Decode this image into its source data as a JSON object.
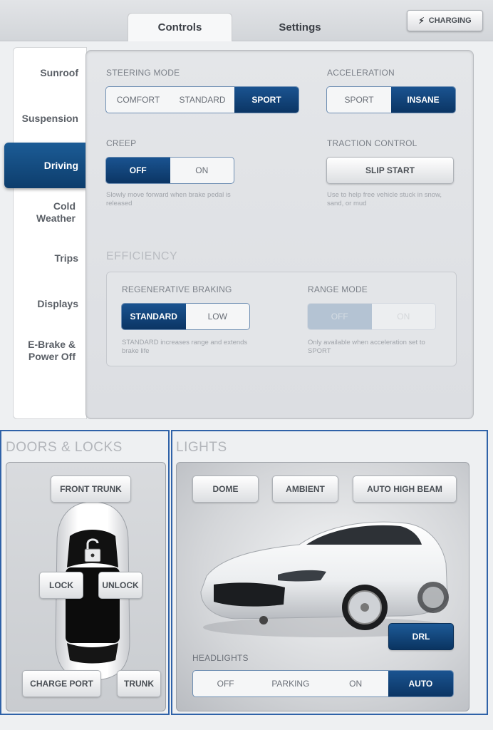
{
  "tabs": [
    "Controls",
    "Settings"
  ],
  "charging_label": "CHARGING",
  "sidebar": {
    "items": [
      "Sunroof",
      "Suspension",
      "Driving",
      "Cold Weather",
      "Trips",
      "Displays",
      "E-Brake & Power Off"
    ],
    "active": "Driving"
  },
  "driving": {
    "steering_mode": {
      "label": "STEERING MODE",
      "options": [
        "COMFORT",
        "STANDARD",
        "SPORT"
      ],
      "selected": "SPORT"
    },
    "acceleration": {
      "label": "ACCELERATION",
      "options": [
        "SPORT",
        "INSANE"
      ],
      "selected": "INSANE"
    },
    "creep": {
      "label": "CREEP",
      "options": [
        "OFF",
        "ON"
      ],
      "selected": "OFF",
      "hint": "Slowly move forward when brake pedal is released"
    },
    "traction_control": {
      "label": "TRACTION CONTROL",
      "button": "SLIP START",
      "hint": "Use to help free vehicle stuck in snow, sand, or mud"
    },
    "efficiency": {
      "title": "EFFICIENCY",
      "regen": {
        "label": "REGENERATIVE BRAKING",
        "options": [
          "STANDARD",
          "LOW"
        ],
        "selected": "STANDARD",
        "hint": "STANDARD increases range and extends brake life"
      },
      "range_mode": {
        "label": "RANGE MODE",
        "options": [
          "OFF",
          "ON"
        ],
        "selected": "OFF",
        "disabled": true,
        "hint": "Only available when acceleration set to SPORT"
      }
    }
  },
  "doors_locks": {
    "title": "DOORS & LOCKS",
    "buttons": {
      "front_trunk": "FRONT TRUNK",
      "lock": "LOCK",
      "unlock": "UNLOCK",
      "charge_port": "CHARGE PORT",
      "trunk": "TRUNK"
    }
  },
  "lights": {
    "title": "LIGHTS",
    "buttons": {
      "dome": "DOME",
      "ambient": "AMBIENT",
      "auto_high_beam": "AUTO HIGH BEAM",
      "drl": "DRL"
    },
    "headlights": {
      "label": "HEADLIGHTS",
      "options": [
        "OFF",
        "PARKING",
        "ON",
        "AUTO"
      ],
      "selected": "AUTO"
    }
  },
  "colors": {
    "accent_blue": "#0d3d6c",
    "section_border": "#2f62a8"
  }
}
